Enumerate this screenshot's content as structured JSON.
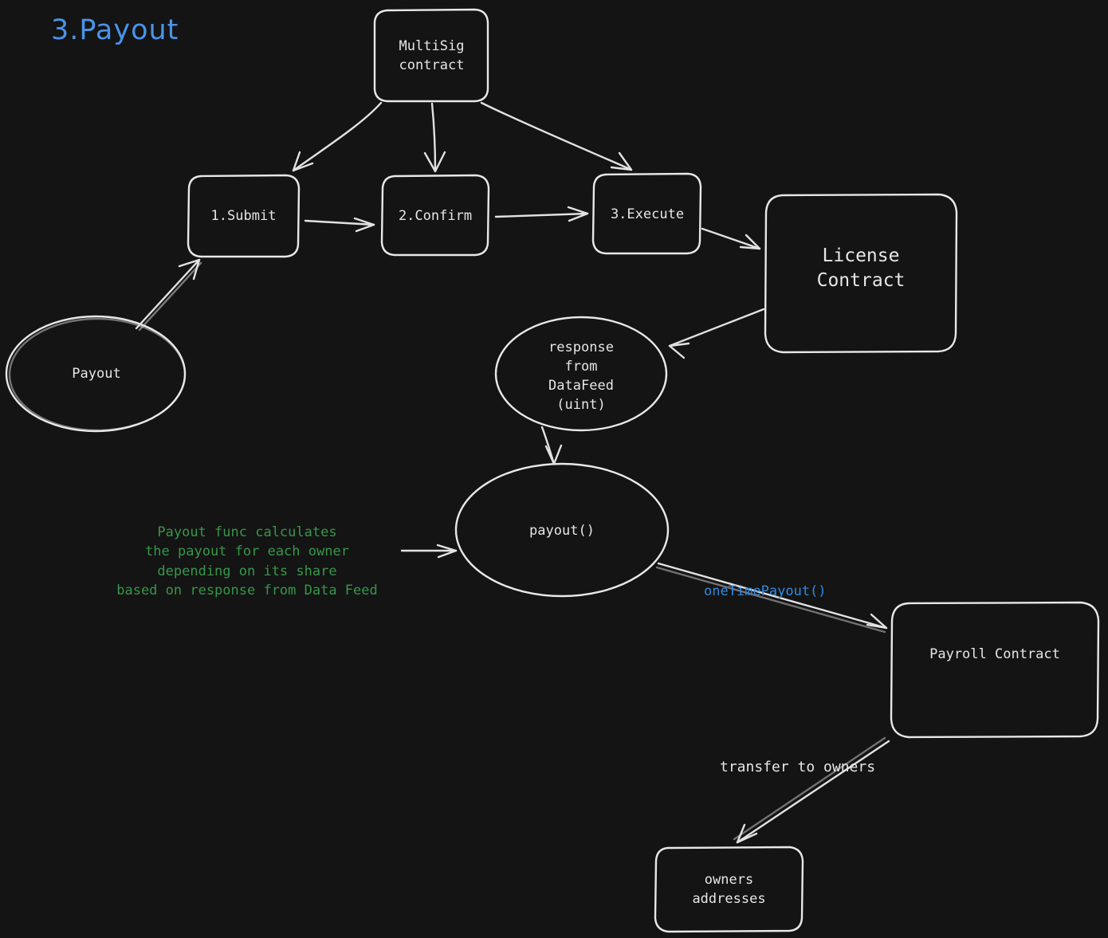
{
  "page": {
    "title": "3.Payout",
    "title_color": "#4a93e8",
    "background_color": "#141414",
    "stroke_color": "#e8e8e8",
    "note_color": "#37964a",
    "accent_color": "#2f8ae0"
  },
  "nodes": {
    "multisig": {
      "label": "MultiSig\ncontract",
      "shape": "rounded-rect"
    },
    "submit": {
      "label": "1.Submit",
      "shape": "rounded-rect"
    },
    "confirm": {
      "label": "2.Confirm",
      "shape": "rounded-rect"
    },
    "execute": {
      "label": "3.Execute",
      "shape": "rounded-rect"
    },
    "license": {
      "label": "License\nContract",
      "shape": "rounded-rect"
    },
    "payout_start": {
      "label": "Payout",
      "shape": "ellipse"
    },
    "response": {
      "label": "response\nfrom\nDataFeed\n(uint)",
      "shape": "ellipse"
    },
    "payout_fn": {
      "label": "payout()",
      "shape": "ellipse"
    },
    "payroll": {
      "label": "Payroll Contract",
      "shape": "rounded-rect"
    },
    "owners": {
      "label": "owners\naddresses",
      "shape": "rounded-rect"
    }
  },
  "notes": {
    "payout_func": "Payout func calculates\nthe payout for each owner\ndepending on its share\nbased on response from Data Feed"
  },
  "edge_labels": {
    "one_time_payout": "oneTimePayout()",
    "transfer_to_owners": "transfer to owners"
  },
  "edges": [
    {
      "from": "multisig",
      "to": "submit",
      "label": ""
    },
    {
      "from": "multisig",
      "to": "confirm",
      "label": ""
    },
    {
      "from": "multisig",
      "to": "execute",
      "label": ""
    },
    {
      "from": "submit",
      "to": "confirm",
      "label": ""
    },
    {
      "from": "confirm",
      "to": "execute",
      "label": ""
    },
    {
      "from": "payout_start",
      "to": "submit",
      "label": ""
    },
    {
      "from": "execute",
      "to": "license",
      "label": ""
    },
    {
      "from": "license",
      "to": "response",
      "label": ""
    },
    {
      "from": "response",
      "to": "payout_fn",
      "label": ""
    },
    {
      "from": "payout_func_note",
      "to": "payout_fn",
      "label": ""
    },
    {
      "from": "payout_fn",
      "to": "payroll",
      "label": "oneTimePayout()"
    },
    {
      "from": "payroll",
      "to": "owners",
      "label": "transfer to owners"
    }
  ]
}
